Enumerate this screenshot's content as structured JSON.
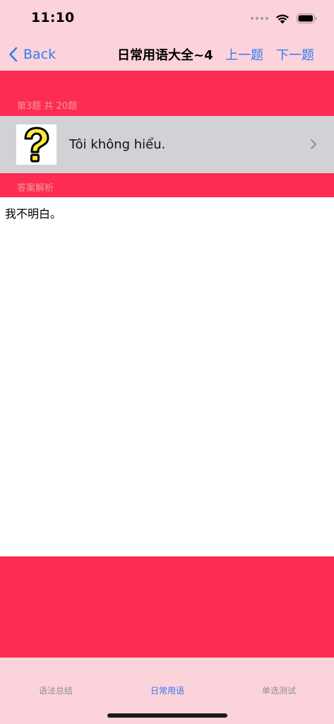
{
  "status_bar": {
    "time": "11:10"
  },
  "nav": {
    "back_label": "Back",
    "title": "日常用语大全~4",
    "prev_label": "上一题",
    "next_label": "下一题"
  },
  "question": {
    "section_label": "第3题 共 20题",
    "image_icon": "question-mark-icon",
    "text": "Tôi không hiểu."
  },
  "answer": {
    "section_label": "答案解析",
    "text": "我不明白。"
  },
  "tabs": [
    {
      "label": "语法总结",
      "active": false
    },
    {
      "label": "日常用语",
      "active": true
    },
    {
      "label": "单选测试",
      "active": false
    }
  ],
  "colors": {
    "accent": "#2f7cf6",
    "header_bg": "#fdd3db",
    "section_red": "#fe2b52",
    "row_gray": "#d2d2d6"
  }
}
